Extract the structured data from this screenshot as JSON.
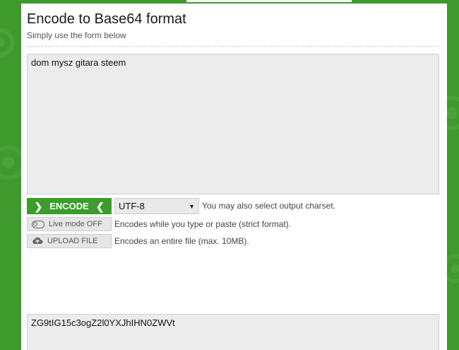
{
  "page": {
    "title": "Encode to Base64 format",
    "subtitle": "Simply use the form below"
  },
  "input": {
    "value": "dom mysz gitara steem"
  },
  "controls": {
    "encode_label": "ENCODE",
    "charset_selected": "UTF-8",
    "charset_hint": "You may also select output charset.",
    "live_mode_label": "Live mode OFF",
    "live_mode_hint": "Encodes while you type or paste (strict format).",
    "upload_label": "UPLOAD FILE",
    "upload_hint": "Encodes an entire file (max. 10MB)."
  },
  "output": {
    "value": "ZG9tIG15c3ogZ2l0YXJhIHN0ZWVt"
  },
  "colors": {
    "brand_green": "#3b9d2a",
    "background_green": "#3e9a2c"
  },
  "icons": {
    "encode_left": "chevron-right-icon",
    "encode_right": "chevron-left-icon",
    "select_arrow": "triangle-down-icon",
    "live_mode": "toggle-off-icon",
    "upload": "cloud-upload-icon"
  }
}
